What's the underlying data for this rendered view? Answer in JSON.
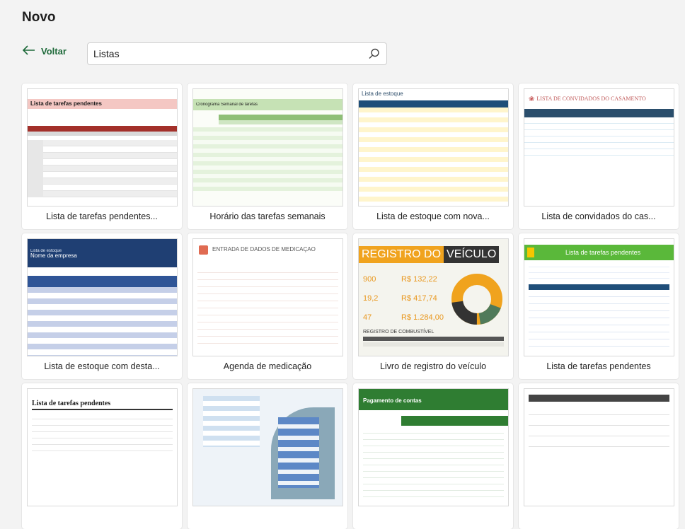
{
  "page": {
    "title": "Novo"
  },
  "nav": {
    "back_label": "Voltar"
  },
  "search": {
    "value": "Listas",
    "placeholder": ""
  },
  "templates": [
    {
      "caption": "Lista de tarefas pendentes...",
      "thumb_title": "Lista de tarefas pendentes"
    },
    {
      "caption": "Horário das tarefas semanais",
      "thumb_title": "Cronograma Semanal de tarefas"
    },
    {
      "caption": "Lista de estoque com nova...",
      "thumb_title": "Lista de estoque"
    },
    {
      "caption": "Lista de convidados do cas...",
      "thumb_title": "LISTA DE CONVIDADOS DO CASAMENTO"
    },
    {
      "caption": "Lista de estoque com desta...",
      "thumb_title": "Lista de estoque",
      "thumb_subtitle": "Nome da empresa"
    },
    {
      "caption": "Agenda de medicação",
      "thumb_title": "ENTRADA DE DADOS DE MEDICAÇÃO"
    },
    {
      "caption": "Livro de registro do veículo",
      "thumb_title_a": "REGISTRO DO",
      "thumb_title_b": "VEÍCULO",
      "thumb_values": [
        "900",
        "R$ 132,22",
        "19,2",
        "R$ 417,74",
        "47",
        "R$ 1.284,00"
      ],
      "thumb_section": "REGISTRO DE COMBUSTÍVEL"
    },
    {
      "caption": "Lista de tarefas pendentes",
      "thumb_title": "Lista de tarefas pendentes"
    },
    {
      "caption": "",
      "thumb_title": "Lista de tarefas pendentes"
    },
    {
      "caption": "",
      "thumb_title": ""
    },
    {
      "caption": "",
      "thumb_title": "Pagamento de contas"
    },
    {
      "caption": "",
      "thumb_title": ""
    }
  ],
  "colors": {
    "accent": "#1e6a3a",
    "background": "#f3f3f3"
  },
  "icons": {
    "back": "arrow-left-icon",
    "search": "search-icon"
  }
}
